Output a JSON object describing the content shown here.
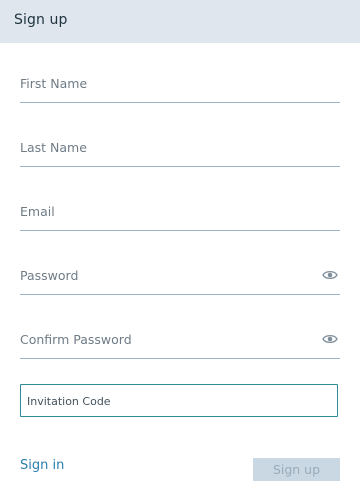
{
  "header": {
    "title": "Sign up"
  },
  "form": {
    "first_name_label": "First Name",
    "last_name_label": "Last Name",
    "email_label": "Email",
    "password_label": "Password",
    "confirm_password_label": "Confirm Password",
    "invitation_code_label": "Invitation Code"
  },
  "footer": {
    "signin_label": "Sign in",
    "signup_label": "Sign up"
  },
  "colors": {
    "header_bg": "#dfe6ed",
    "accent": "#2f8b95",
    "link": "#2a7fae",
    "disabled_button_bg": "#c9d8e3"
  },
  "icons": [
    "eye-icon"
  ]
}
